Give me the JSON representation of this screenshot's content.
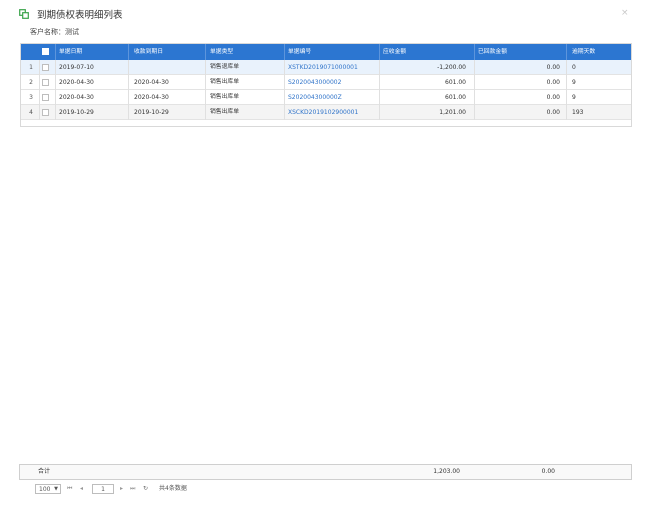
{
  "dialog": {
    "title": "到期债权表明细列表",
    "close_symbol": "×",
    "customer_label": "客户名称：测试"
  },
  "table": {
    "columns": [
      "单据日期",
      "收款到期日",
      "单据类型",
      "单据编号",
      "应收金额",
      "已回款金额",
      "逾期天数"
    ],
    "rows": [
      {
        "num": "1",
        "date": "2019-07-10",
        "due": "",
        "type": "销售退库单",
        "code": "XSTKD2019071000001",
        "amount": "-1,200.00",
        "received": "0.00",
        "overdue": "0"
      },
      {
        "num": "2",
        "date": "2020-04-30",
        "due": "2020-04-30",
        "type": "销售出库单",
        "code": "S2020043000002",
        "amount": "601.00",
        "received": "0.00",
        "overdue": "9"
      },
      {
        "num": "3",
        "date": "2020-04-30",
        "due": "2020-04-30",
        "type": "销售出库单",
        "code": "S202004300000Z",
        "amount": "601.00",
        "received": "0.00",
        "overdue": "9"
      },
      {
        "num": "4",
        "date": "2019-10-29",
        "due": "2019-10-29",
        "type": "销售出库单",
        "code": "XSCKD2019102900001",
        "amount": "1,201.00",
        "received": "0.00",
        "overdue": "193"
      }
    ]
  },
  "footer": {
    "label": "合计",
    "amount_total": "1,203.00",
    "received_total": "0.00"
  },
  "pager": {
    "page_size": "100",
    "page_size_arrow": "▼",
    "first": "⏮",
    "prev": "◂",
    "current_page": "1",
    "next": "▸",
    "last": "⏭",
    "refresh": "↻",
    "total_text": "共4条数据"
  },
  "colors": {
    "header_bg": "#2c76d1",
    "link": "#2f73c9",
    "icon": "#3aa34a"
  }
}
